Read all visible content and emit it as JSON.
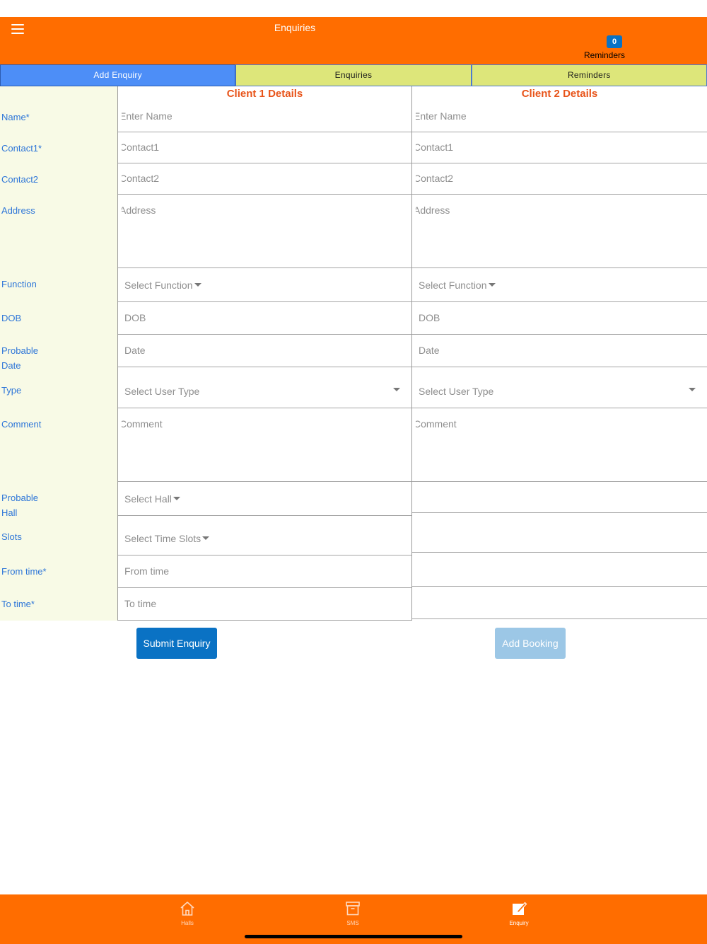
{
  "header": {
    "title": "Enquiries",
    "reminder_count": "0",
    "reminders_label": "Reminders"
  },
  "tabs": [
    {
      "label": "Add Enquiry",
      "active": true
    },
    {
      "label": "Enquiries",
      "active": false
    },
    {
      "label": "Reminders",
      "active": false
    }
  ],
  "labels": {
    "name": "Name*",
    "contact1": "Contact1*",
    "contact2": "Contact2",
    "address": "Address",
    "function": "Function",
    "dob": "DOB",
    "probable_date_line1": "Probable",
    "probable_date_line2": "Date",
    "type": "Type",
    "comment": "Comment",
    "probable_hall_line1": "Probable",
    "probable_hall_line2": "Hall",
    "slots": "Slots",
    "from_time": "From time*",
    "to_time": "To time*"
  },
  "client1": {
    "title": "Client 1 Details",
    "name": "Enter Name",
    "contact1": "Contact1",
    "contact2": "Contact2",
    "address": "Address",
    "function": "Select Function",
    "dob": "DOB",
    "date": "Date",
    "type": "Select User Type",
    "comment": "Comment",
    "hall": "Select Hall",
    "slots": "Select Time Slots",
    "from_time": "From time",
    "to_time": "To time"
  },
  "client2": {
    "title": "Client 2 Details",
    "name": "Enter Name",
    "contact1": "Contact1",
    "contact2": "Contact2",
    "address": "Address",
    "function": "Select Function",
    "dob": "DOB",
    "date": "Date",
    "type": "Select User Type",
    "comment": "Comment"
  },
  "buttons": {
    "submit": "Submit Enquiry",
    "add_booking": "Add Booking"
  },
  "bottom_nav": [
    {
      "label": "Halls",
      "icon": "home-icon",
      "active": false
    },
    {
      "label": "SMS",
      "icon": "archive-icon",
      "active": false
    },
    {
      "label": "Enquiry",
      "icon": "edit-icon",
      "active": true
    }
  ],
  "colors": {
    "primary_orange": "#ff6d00",
    "active_tab": "#4d8ef7",
    "inactive_tab": "#dde67a",
    "label_blue": "#2e76d8",
    "section_title": "#e8541a",
    "submit_button": "#0a72c4",
    "disabled_button": "#9cc7e6",
    "label_column_bg": "#f8fae6"
  }
}
